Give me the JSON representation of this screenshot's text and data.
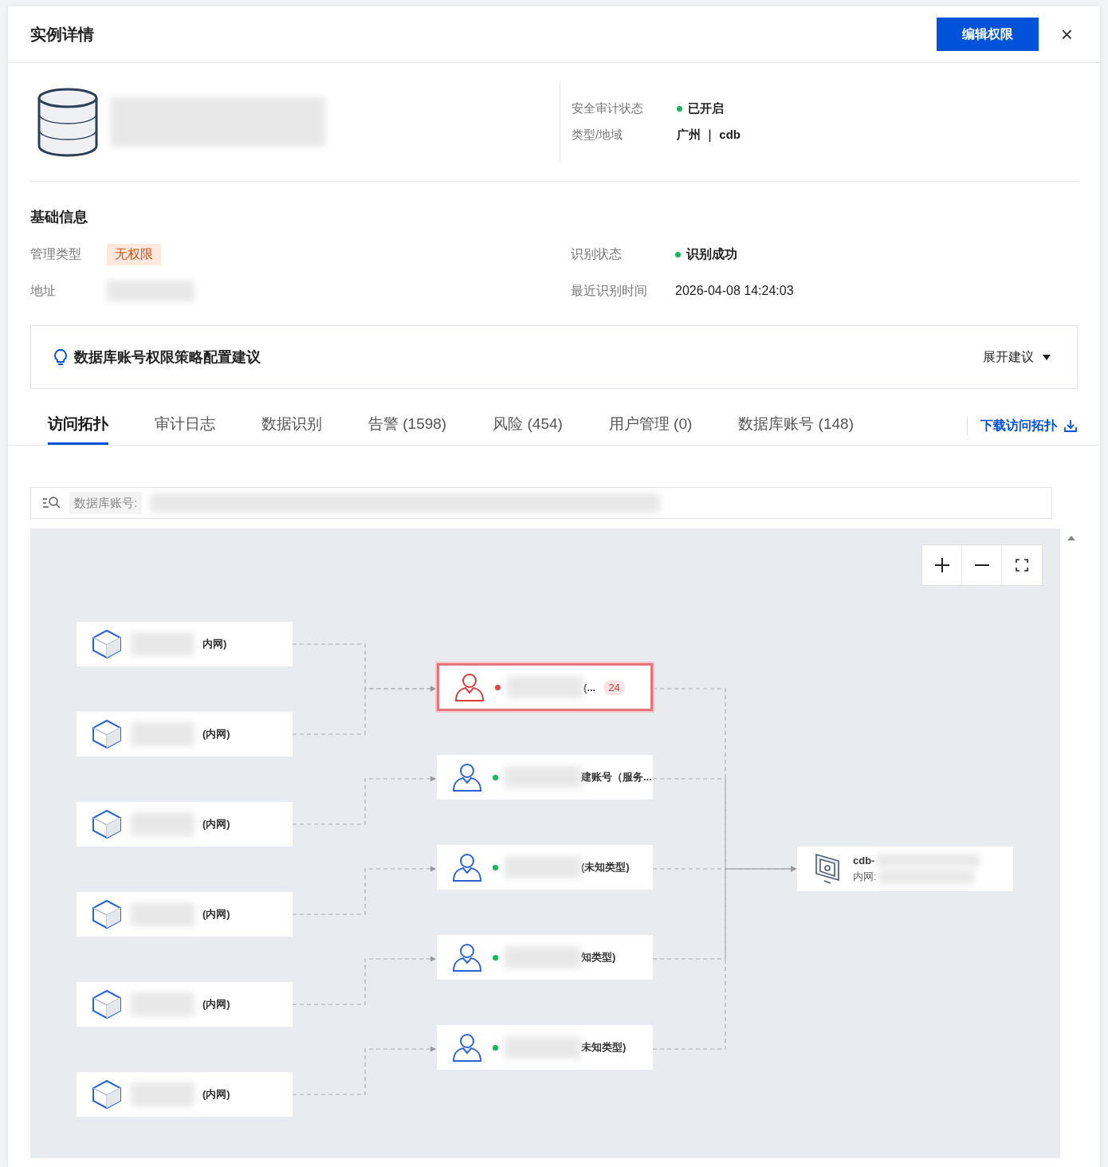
{
  "header": {
    "title": "实例详情",
    "primary_button": "编辑权限",
    "close": "×"
  },
  "summary": {
    "fields": [
      {
        "label": "安全审计状态",
        "value": "已开启",
        "color": "#16b65b"
      },
      {
        "label": "类型/地域",
        "value": "广州 ｜ cdb"
      }
    ]
  },
  "basic_info": {
    "title": "基础信息",
    "left": [
      {
        "label": "管理类型",
        "kind": "tag",
        "value": "无权限"
      },
      {
        "label": "地址",
        "kind": "redacted"
      }
    ],
    "right": [
      {
        "label": "识别状态",
        "kind": "status",
        "value": "识别成功",
        "color": "#16b65b"
      },
      {
        "label": "最近识别时间",
        "kind": "text",
        "value": "2026-04-08 14:24:03"
      }
    ]
  },
  "suggestion": {
    "title": "数据库账号权限策略配置建议",
    "toggle": "展开建议",
    "expanded": false
  },
  "tabs": [
    {
      "label": "访问拓扑",
      "selected": true
    },
    {
      "label": "审计日志",
      "selected": false
    },
    {
      "label": "数据识别",
      "selected": false
    },
    {
      "label": "告警 (1598)",
      "selected": false
    },
    {
      "label": "风险 (454)",
      "selected": false
    },
    {
      "label": "用户管理 (0)",
      "selected": false
    },
    {
      "label": "数据库账号 (148)",
      "selected": false
    }
  ],
  "download_link": "下载访问拓扑",
  "search": {
    "prefix": "数据库账号:"
  },
  "topology": {
    "sources": [
      {
        "label": "内网)"
      },
      {
        "label": "(内网)"
      },
      {
        "label": "(内网)"
      },
      {
        "label": "(内网)"
      },
      {
        "label": "(内网)"
      },
      {
        "label": "(内网)"
      }
    ],
    "accounts": [
      {
        "label": "(...",
        "alert": true,
        "color": "#e54545",
        "badge": "24"
      },
      {
        "label": "建账号（服务...",
        "alert": false,
        "color": "#16b65b"
      },
      {
        "label": "(未知类型)",
        "alert": false,
        "color": "#16b65b"
      },
      {
        "label": "知类型)",
        "alert": false,
        "color": "#16b65b"
      },
      {
        "label": "未知类型)",
        "alert": false,
        "color": "#16b65b"
      }
    ],
    "instance": {
      "name": "cdb-",
      "network": "内网:"
    }
  }
}
